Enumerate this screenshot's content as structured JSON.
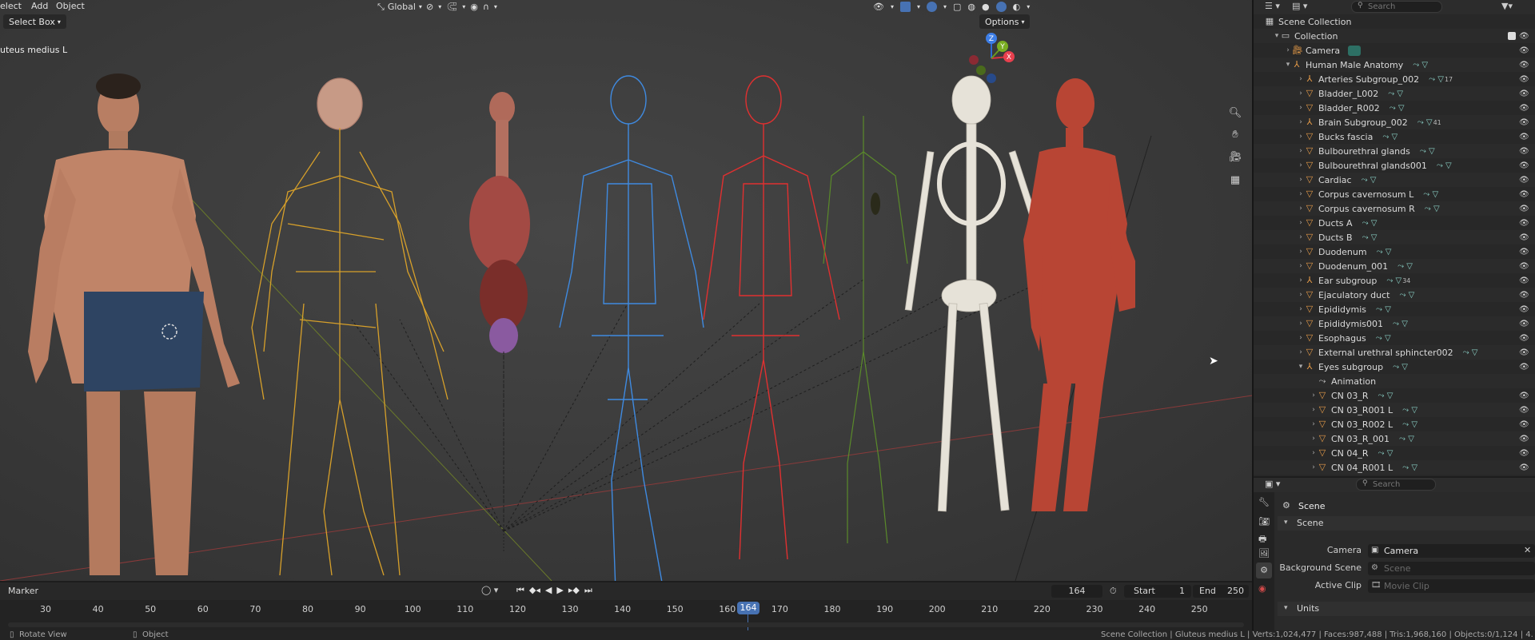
{
  "viewport": {
    "menu": [
      "elect",
      "Add",
      "Object"
    ],
    "select_mode": "Select Box",
    "orientation": "Global",
    "options_label": "Options",
    "active_object_label": "uteus medius L",
    "gizmo_axes": {
      "x": "X",
      "y": "Y",
      "z": "Z"
    }
  },
  "outliner": {
    "search_placeholder": "Search",
    "rows": [
      {
        "label": "Scene Collection",
        "type": "scene"
      },
      {
        "label": "Collection",
        "type": "collection"
      },
      {
        "label": "Camera",
        "type": "camera"
      },
      {
        "label": "Human Male Anatomy",
        "type": "empty"
      },
      {
        "label": "Arteries Subgroup_002",
        "type": "empty",
        "badge": "17"
      },
      {
        "label": "Bladder_L002",
        "type": "mesh"
      },
      {
        "label": "Bladder_R002",
        "type": "mesh"
      },
      {
        "label": "Brain Subgroup_002",
        "type": "empty",
        "badge": "41"
      },
      {
        "label": "Bucks fascia",
        "type": "mesh"
      },
      {
        "label": "Bulbourethral glands",
        "type": "mesh"
      },
      {
        "label": "Bulbourethral glands001",
        "type": "mesh"
      },
      {
        "label": "Cardiac",
        "type": "mesh"
      },
      {
        "label": "Corpus cavernosum L",
        "type": "mesh"
      },
      {
        "label": "Corpus cavernosum R",
        "type": "mesh"
      },
      {
        "label": "Ducts A",
        "type": "mesh"
      },
      {
        "label": "Ducts B",
        "type": "mesh"
      },
      {
        "label": "Duodenum",
        "type": "mesh"
      },
      {
        "label": "Duodenum_001",
        "type": "mesh"
      },
      {
        "label": "Ear subgroup",
        "type": "empty",
        "badge": "34"
      },
      {
        "label": "Ejaculatory duct",
        "type": "mesh"
      },
      {
        "label": "Epididymis",
        "type": "mesh"
      },
      {
        "label": "Epididymis001",
        "type": "mesh"
      },
      {
        "label": "Esophagus",
        "type": "mesh"
      },
      {
        "label": "External urethral sphincter002",
        "type": "mesh"
      },
      {
        "label": "Eyes subgroup",
        "type": "empty"
      },
      {
        "label": "Animation",
        "type": "anim"
      },
      {
        "label": "CN 03_R",
        "type": "mesh"
      },
      {
        "label": "CN 03_R001 L",
        "type": "mesh"
      },
      {
        "label": "CN 03_R002 L",
        "type": "mesh"
      },
      {
        "label": "CN 03_R_001",
        "type": "mesh"
      },
      {
        "label": "CN 04_R",
        "type": "mesh"
      },
      {
        "label": "CN 04_R001 L",
        "type": "mesh"
      }
    ]
  },
  "properties": {
    "search_placeholder": "Search",
    "context": "Scene",
    "panel_scene": "Scene",
    "camera_label": "Camera",
    "camera_value": "Camera",
    "bg_scene_label": "Background Scene",
    "bg_scene_value": "Scene",
    "active_clip_label": "Active Clip",
    "active_clip_value": "Movie Clip",
    "panel_units": "Units"
  },
  "timeline": {
    "marker_label": "Marker",
    "current_frame": "164",
    "start_label": "Start",
    "start_value": "1",
    "end_label": "End",
    "end_value": "250",
    "ruler": [
      "30",
      "40",
      "50",
      "60",
      "70",
      "80",
      "90",
      "100",
      "110",
      "120",
      "130",
      "140",
      "150",
      "160",
      "170",
      "180",
      "190",
      "200",
      "210",
      "220",
      "230",
      "240",
      "250"
    ],
    "playhead": "164"
  },
  "statusbar": {
    "left": "Rotate View",
    "mid": "Object",
    "right": "Scene Collection | Gluteus medius L | Verts:1,024,477 | Faces:987,488 | Tris:1,968,160 | Objects:0/1,124 | 4."
  },
  "colors": {
    "accent": "#4772b3",
    "nervous": "#d7a02a",
    "veins": "#3f8ae0",
    "arteries": "#e03030",
    "lymph": "#5a8a2a",
    "skeleton": "#e6e2d8",
    "muscle": "#b84534"
  }
}
